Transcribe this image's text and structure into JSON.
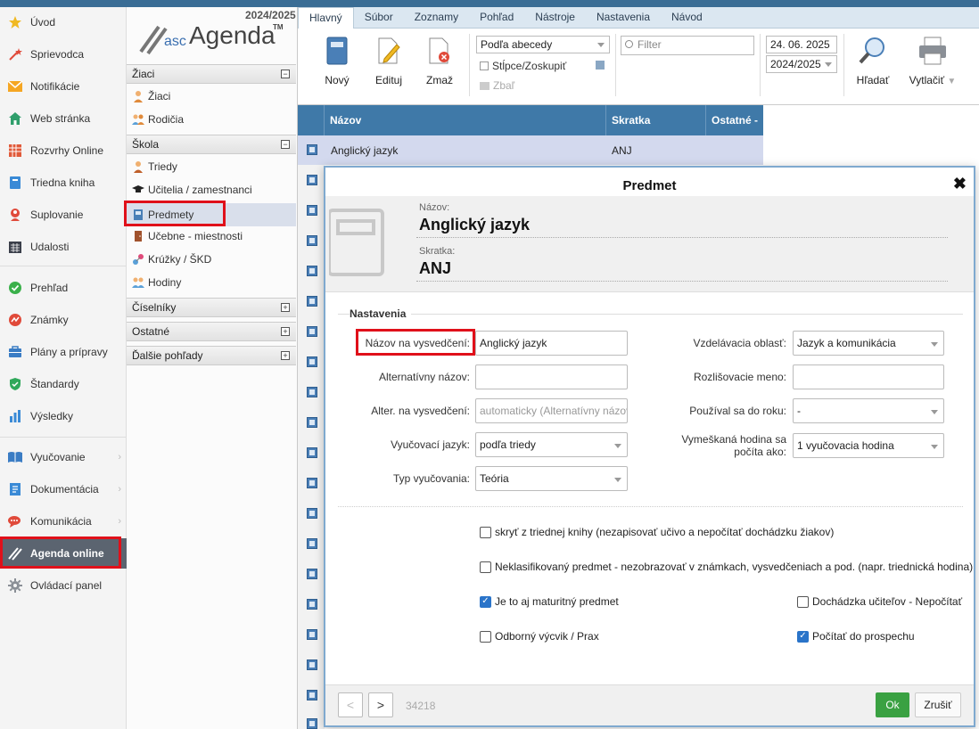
{
  "nav": {
    "items": [
      {
        "label": "Úvod",
        "icon": "star-icon"
      },
      {
        "label": "Sprievodca",
        "icon": "wand-icon"
      },
      {
        "label": "Notifikácie",
        "icon": "envelope-icon"
      },
      {
        "label": "Web stránka",
        "icon": "home-icon"
      },
      {
        "label": "Rozvrhy Online",
        "icon": "grid-icon"
      },
      {
        "label": "Triedna kniha",
        "icon": "book-icon"
      },
      {
        "label": "Suplovanie",
        "icon": "person-icon"
      },
      {
        "label": "Udalosti",
        "icon": "calendar-icon"
      },
      {
        "label": "Prehľad",
        "icon": "check-circle-icon"
      },
      {
        "label": "Známky",
        "icon": "chart-circle-icon"
      },
      {
        "label": "Plány a prípravy",
        "icon": "briefcase-icon"
      },
      {
        "label": "Štandardy",
        "icon": "shield-icon"
      },
      {
        "label": "Výsledky",
        "icon": "bar-chart-icon"
      },
      {
        "label": "Vyučovanie",
        "icon": "open-book-icon"
      },
      {
        "label": "Dokumentácia",
        "icon": "document-icon"
      },
      {
        "label": "Komunikácia",
        "icon": "chat-icon"
      },
      {
        "label": "Agenda online",
        "icon": "agenda-icon"
      },
      {
        "label": "Ovládací panel",
        "icon": "gear-icon"
      }
    ],
    "chevron": "›"
  },
  "app": {
    "year": "2024/2025",
    "logo_prefix": "asc",
    "logo_main": "Agenda",
    "logo_tm": "TM"
  },
  "tree": {
    "groups": {
      "ziaci": "Žiaci",
      "skola": "Škola",
      "ciselniky": "Číselníky",
      "ostatne": "Ostatné",
      "dalsie": "Ďalšie pohľady"
    },
    "collapse": "−",
    "expand": "+",
    "items": {
      "ziaci": "Žiaci",
      "rodicia": "Rodičia",
      "triedy": "Triedy",
      "ucitelia": "Učitelia / zamestnanci",
      "predmety": "Predmety",
      "ucebne": "Učebne - miestnosti",
      "kruzky": "Krúžky / ŠKD",
      "hodiny": "Hodiny"
    }
  },
  "toolbar": {
    "tabs": [
      "Hlavný",
      "Súbor",
      "Zoznamy",
      "Pohľad",
      "Nástroje",
      "Nastavenia",
      "Návod"
    ],
    "new": "Nový",
    "edit": "Edituj",
    "delete": "Zmaž",
    "sort": "Podľa abecedy",
    "columns": "Stĺpce/Zoskupiť",
    "collapse": "Zbaľ",
    "filter_placeholder": "Filter",
    "date": "24. 06. 2025",
    "year": "2024/2025",
    "search": "Hľadať",
    "print": "Vytlačiť"
  },
  "grid": {
    "headers": [
      "Názov",
      "Skratka",
      "Ostatné -"
    ],
    "selected_row": {
      "name": "Anglický jazyk",
      "abbr": "ANJ"
    }
  },
  "dialog": {
    "title": "Predmet",
    "close": "✖",
    "name_label": "Názov:",
    "name_value": "Anglický jazyk",
    "abbr_label": "Skratka:",
    "abbr_value": "ANJ",
    "section": "Nastavenia",
    "fields": {
      "report_name_label": "Názov na vysvedčení:",
      "report_name_value": "Anglický jazyk",
      "alt_name_label": "Alternatívny názov:",
      "alt_name_value": "",
      "alt_report_label": "Alter. na vysvedčení:",
      "alt_report_placeholder": "automaticky (Alternatívny názov)",
      "lang_label": "Vyučovací jazyk:",
      "lang_value": "podľa triedy",
      "type_label": "Typ vyučovania:",
      "type_value": "Teória",
      "area_label": "Vzdelávacia oblasť:",
      "area_value": "Jazyk a komunikácia",
      "distinct_label": "Rozlišovacie meno:",
      "distinct_value": "",
      "used_label": "Používal sa do roku:",
      "used_value": "-",
      "missed_label_1": "Vymeškaná hodina sa",
      "missed_label_2": "počíta ako:",
      "missed_value": "1 vyučovacia hodina"
    },
    "checks": {
      "hide": {
        "label": "skryť z triednej knihy (nezapisovať učivo a nepočítať dochádzku žiakov)",
        "checked": false
      },
      "unclassified": {
        "label": "Neklasifikovaný predmet - nezobrazovať v známkach, vysvedčeniach a pod. (napr. triednická hodina)",
        "checked": false
      },
      "matura": {
        "label": "Je to aj maturitný predmet",
        "checked": true
      },
      "attendance": {
        "label": "Dochádzka učiteľov - Nepočítať",
        "checked": false
      },
      "vocational": {
        "label": "Odborný výcvik / Prax",
        "checked": false
      },
      "average": {
        "label": "Počítať do prospechu",
        "checked": true
      }
    },
    "footer": {
      "prev": "<",
      "next": ">",
      "record_id": "34218",
      "ok": "Ok",
      "cancel": "Zrušiť"
    }
  }
}
